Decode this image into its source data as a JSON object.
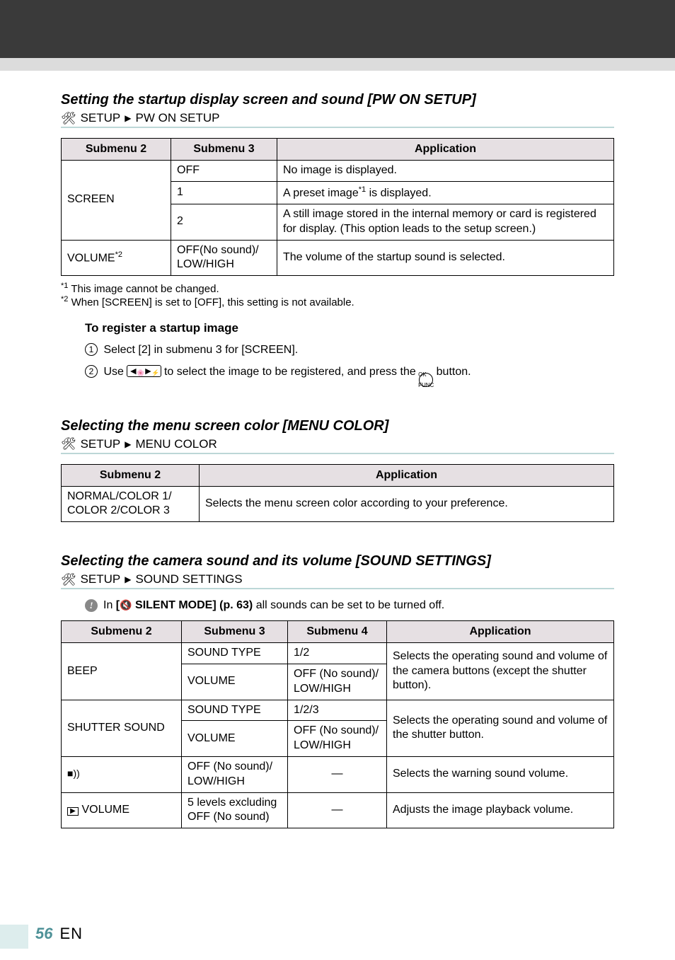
{
  "pwon": {
    "title": "Setting the startup display screen and sound [PW ON SETUP]",
    "path_setup": "SETUP",
    "path_arrow": "▶",
    "path_leaf": "PW ON SETUP",
    "headers": {
      "sub2": "Submenu 2",
      "sub3": "Submenu 3",
      "app": "Application"
    },
    "rows": {
      "screen_label": "SCREEN",
      "screen_off_sub3": "OFF",
      "screen_off_app": "No image is displayed.",
      "screen_1_sub3": "1",
      "screen_1_app_pre": "A preset image",
      "screen_1_app_sup": "*1",
      "screen_1_app_post": " is displayed.",
      "screen_2_sub3": "2",
      "screen_2_app": "A still image stored in the internal memory or card is registered for display. (This option leads to the setup screen.)",
      "volume_label_pre": "VOLUME",
      "volume_label_sup": "*2",
      "volume_sub3": "OFF(No sound)/\nLOW/HIGH",
      "volume_app": "The volume of the startup sound is selected."
    },
    "footnotes": {
      "f1_sup": "*1",
      "f1_text": "This image cannot be changed.",
      "f2_sup": "*2",
      "f2_text": "When [SCREEN] is set to [OFF], this setting is not available."
    },
    "register": {
      "heading": "To register a startup image",
      "step1": "Select [2] in submenu 3 for [SCREEN].",
      "step2_pre": "Use ",
      "step2_mid": " to select the image to be registered, and press the ",
      "step2_post": " button."
    }
  },
  "menucolor": {
    "title": "Selecting the menu screen color [MENU COLOR]",
    "path_setup": "SETUP",
    "path_arrow": "▶",
    "path_leaf": "MENU COLOR",
    "headers": {
      "sub2": "Submenu 2",
      "app": "Application"
    },
    "row": {
      "sub2": "NORMAL/COLOR 1/\nCOLOR 2/COLOR 3",
      "app": "Selects the menu screen color according to your preference."
    }
  },
  "sound": {
    "title": "Selecting the camera sound and its volume [SOUND SETTINGS]",
    "path_setup": "SETUP",
    "path_arrow": "▶",
    "path_leaf": "SOUND SETTINGS",
    "info_in": "In ",
    "info_bold": "SILENT MODE] (p. 63)",
    "info_bracket": "[",
    "info_rest": " all sounds can be set to be turned off.",
    "headers": {
      "sub2": "Submenu 2",
      "sub3": "Submenu 3",
      "sub4": "Submenu 4",
      "app": "Application"
    },
    "rows": {
      "beep_label": "BEEP",
      "beep_sndtype_sub3": "SOUND TYPE",
      "beep_sndtype_sub4": "1/2",
      "beep_app": "Selects the operating sound and volume of the camera buttons (except the shutter button).",
      "beep_vol_sub3": "VOLUME",
      "beep_vol_sub4": "OFF (No sound)/\nLOW/HIGH",
      "shutter_label": "SHUTTER SOUND",
      "shutter_sndtype_sub3": "SOUND TYPE",
      "shutter_sndtype_sub4": "1/2/3",
      "shutter_app": "Selects the operating sound and volume of the shutter button.",
      "shutter_vol_sub3": "VOLUME",
      "shutter_vol_sub4": "OFF (No sound)/\nLOW/HIGH",
      "warn_sub3": "OFF (No sound)/\nLOW/HIGH",
      "warn_sub4": "—",
      "warn_app": "Selects the warning sound volume.",
      "play_vol_label": " VOLUME",
      "play_sub3": "5 levels excluding OFF (No sound)",
      "play_sub4": "—",
      "play_app": "Adjusts the image playback volume."
    }
  },
  "footer": {
    "page": "56",
    "lang": "EN"
  }
}
